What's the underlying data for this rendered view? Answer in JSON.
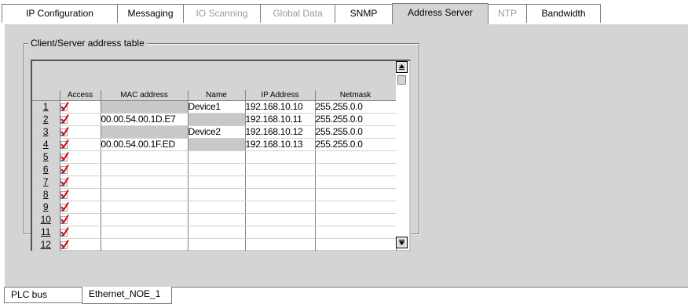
{
  "top_tabs": [
    {
      "label": "IP  Configuration",
      "state": "normal"
    },
    {
      "label": "Messaging",
      "state": "normal"
    },
    {
      "label": "IO Scanning",
      "state": "disabled"
    },
    {
      "label": "Global Data",
      "state": "disabled"
    },
    {
      "label": "SNMP",
      "state": "normal"
    },
    {
      "label": "Address Server",
      "state": "active"
    },
    {
      "label": "NTP",
      "state": "disabled"
    },
    {
      "label": "Bandwidth",
      "state": "normal"
    }
  ],
  "group": {
    "title": "Client/Server address table"
  },
  "table": {
    "columns": [
      "Access",
      "MAC address",
      "Name",
      "IP Address",
      "Netmask"
    ],
    "rows": [
      {
        "num": "1",
        "access": true,
        "mac": "",
        "name": "Device1",
        "ip": "192.168.10.10",
        "netmask": "255.255.0.0"
      },
      {
        "num": "2",
        "access": true,
        "mac": "00.00.54.00.1D.E7",
        "name": "",
        "ip": "192.168.10.11",
        "netmask": "255.255.0.0"
      },
      {
        "num": "3",
        "access": true,
        "mac": "",
        "name": "Device2",
        "ip": "192.168.10.12",
        "netmask": "255.255.0.0"
      },
      {
        "num": "4",
        "access": true,
        "mac": "00.00.54.00.1F.ED",
        "name": "",
        "ip": "192.168.10.13",
        "netmask": "255.255.0.0"
      },
      {
        "num": "5",
        "access": true,
        "mac": "",
        "name": "",
        "ip": "",
        "netmask": ""
      },
      {
        "num": "6",
        "access": true,
        "mac": "",
        "name": "",
        "ip": "",
        "netmask": ""
      },
      {
        "num": "7",
        "access": true,
        "mac": "",
        "name": "",
        "ip": "",
        "netmask": ""
      },
      {
        "num": "8",
        "access": true,
        "mac": "",
        "name": "",
        "ip": "",
        "netmask": ""
      },
      {
        "num": "9",
        "access": true,
        "mac": "",
        "name": "",
        "ip": "",
        "netmask": ""
      },
      {
        "num": "10",
        "access": true,
        "mac": "",
        "name": "",
        "ip": "",
        "netmask": ""
      },
      {
        "num": "11",
        "access": true,
        "mac": "",
        "name": "",
        "ip": "",
        "netmask": ""
      },
      {
        "num": "12",
        "access": true,
        "mac": "",
        "name": "",
        "ip": "",
        "netmask": ""
      }
    ]
  },
  "scrollbar": {
    "up_icon": "scroll-up-icon",
    "down_icon": "scroll-down-icon"
  },
  "bottom_tabs": [
    {
      "label": "PLC bus",
      "state": "normal"
    },
    {
      "label": "Ethernet_NOE_1",
      "state": "active"
    }
  ],
  "colors": {
    "panel_bg": "#d4d4d4",
    "shaded_cell": "#c8c8c8",
    "check_red": "#e00000",
    "check_blue": "#3050c0"
  }
}
